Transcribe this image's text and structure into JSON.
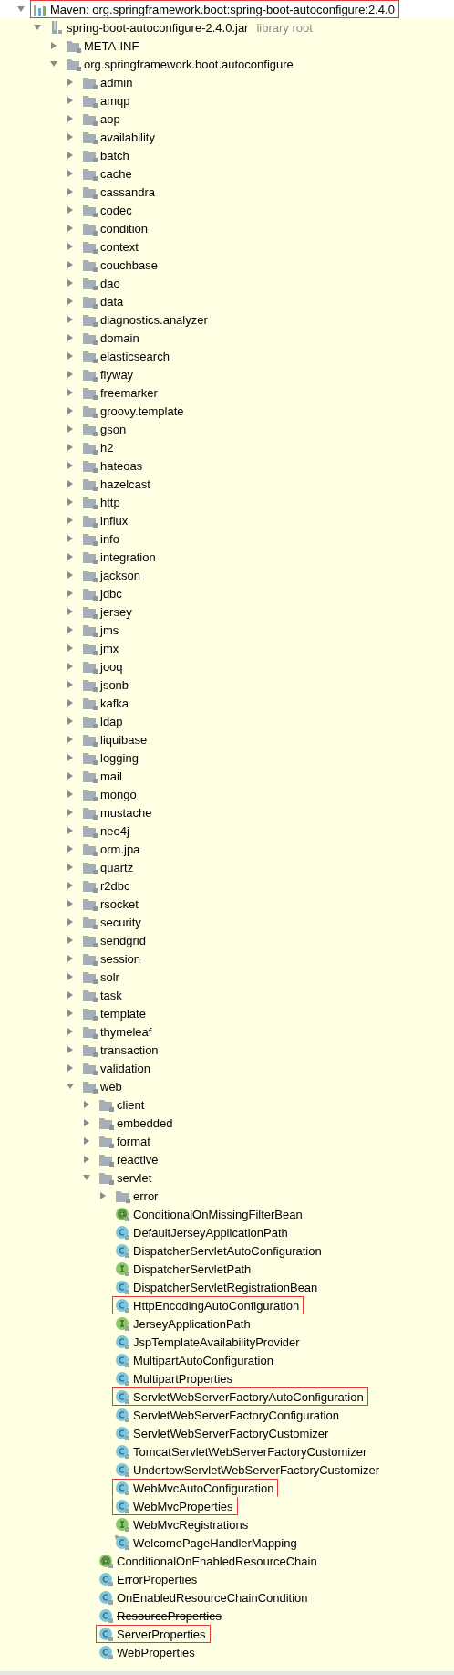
{
  "tree": [
    {
      "label": "Maven: org.springframework.boot:spring-boot-autoconfigure:2.4.0",
      "kind": "library",
      "expanded": true,
      "highlighted": true,
      "children": [
        {
          "label": "spring-boot-autoconfigure-2.4.0.jar",
          "note": "library root",
          "kind": "jar",
          "expanded": true,
          "children": [
            {
              "label": "META-INF",
              "kind": "folder",
              "expanded": false
            },
            {
              "label": "org.springframework.boot.autoconfigure",
              "kind": "folder",
              "expanded": true,
              "children": [
                {
                  "label": "admin",
                  "kind": "folder",
                  "expanded": false
                },
                {
                  "label": "amqp",
                  "kind": "folder",
                  "expanded": false
                },
                {
                  "label": "aop",
                  "kind": "folder",
                  "expanded": false
                },
                {
                  "label": "availability",
                  "kind": "folder",
                  "expanded": false
                },
                {
                  "label": "batch",
                  "kind": "folder",
                  "expanded": false
                },
                {
                  "label": "cache",
                  "kind": "folder",
                  "expanded": false
                },
                {
                  "label": "cassandra",
                  "kind": "folder",
                  "expanded": false
                },
                {
                  "label": "codec",
                  "kind": "folder",
                  "expanded": false
                },
                {
                  "label": "condition",
                  "kind": "folder",
                  "expanded": false
                },
                {
                  "label": "context",
                  "kind": "folder",
                  "expanded": false
                },
                {
                  "label": "couchbase",
                  "kind": "folder",
                  "expanded": false
                },
                {
                  "label": "dao",
                  "kind": "folder",
                  "expanded": false
                },
                {
                  "label": "data",
                  "kind": "folder",
                  "expanded": false
                },
                {
                  "label": "diagnostics.analyzer",
                  "kind": "folder",
                  "expanded": false
                },
                {
                  "label": "domain",
                  "kind": "folder",
                  "expanded": false
                },
                {
                  "label": "elasticsearch",
                  "kind": "folder",
                  "expanded": false
                },
                {
                  "label": "flyway",
                  "kind": "folder",
                  "expanded": false
                },
                {
                  "label": "freemarker",
                  "kind": "folder",
                  "expanded": false
                },
                {
                  "label": "groovy.template",
                  "kind": "folder",
                  "expanded": false
                },
                {
                  "label": "gson",
                  "kind": "folder",
                  "expanded": false
                },
                {
                  "label": "h2",
                  "kind": "folder",
                  "expanded": false
                },
                {
                  "label": "hateoas",
                  "kind": "folder",
                  "expanded": false
                },
                {
                  "label": "hazelcast",
                  "kind": "folder",
                  "expanded": false
                },
                {
                  "label": "http",
                  "kind": "folder",
                  "expanded": false
                },
                {
                  "label": "influx",
                  "kind": "folder",
                  "expanded": false
                },
                {
                  "label": "info",
                  "kind": "folder",
                  "expanded": false
                },
                {
                  "label": "integration",
                  "kind": "folder",
                  "expanded": false
                },
                {
                  "label": "jackson",
                  "kind": "folder",
                  "expanded": false
                },
                {
                  "label": "jdbc",
                  "kind": "folder",
                  "expanded": false
                },
                {
                  "label": "jersey",
                  "kind": "folder",
                  "expanded": false
                },
                {
                  "label": "jms",
                  "kind": "folder",
                  "expanded": false
                },
                {
                  "label": "jmx",
                  "kind": "folder",
                  "expanded": false
                },
                {
                  "label": "jooq",
                  "kind": "folder",
                  "expanded": false
                },
                {
                  "label": "jsonb",
                  "kind": "folder",
                  "expanded": false
                },
                {
                  "label": "kafka",
                  "kind": "folder",
                  "expanded": false
                },
                {
                  "label": "ldap",
                  "kind": "folder",
                  "expanded": false
                },
                {
                  "label": "liquibase",
                  "kind": "folder",
                  "expanded": false
                },
                {
                  "label": "logging",
                  "kind": "folder",
                  "expanded": false
                },
                {
                  "label": "mail",
                  "kind": "folder",
                  "expanded": false
                },
                {
                  "label": "mongo",
                  "kind": "folder",
                  "expanded": false
                },
                {
                  "label": "mustache",
                  "kind": "folder",
                  "expanded": false
                },
                {
                  "label": "neo4j",
                  "kind": "folder",
                  "expanded": false
                },
                {
                  "label": "orm.jpa",
                  "kind": "folder",
                  "expanded": false
                },
                {
                  "label": "quartz",
                  "kind": "folder",
                  "expanded": false
                },
                {
                  "label": "r2dbc",
                  "kind": "folder",
                  "expanded": false
                },
                {
                  "label": "rsocket",
                  "kind": "folder",
                  "expanded": false
                },
                {
                  "label": "security",
                  "kind": "folder",
                  "expanded": false
                },
                {
                  "label": "sendgrid",
                  "kind": "folder",
                  "expanded": false
                },
                {
                  "label": "session",
                  "kind": "folder",
                  "expanded": false
                },
                {
                  "label": "solr",
                  "kind": "folder",
                  "expanded": false
                },
                {
                  "label": "task",
                  "kind": "folder",
                  "expanded": false
                },
                {
                  "label": "template",
                  "kind": "folder",
                  "expanded": false
                },
                {
                  "label": "thymeleaf",
                  "kind": "folder",
                  "expanded": false
                },
                {
                  "label": "transaction",
                  "kind": "folder",
                  "expanded": false
                },
                {
                  "label": "validation",
                  "kind": "folder",
                  "expanded": false
                },
                {
                  "label": "web",
                  "kind": "folder",
                  "expanded": true,
                  "children": [
                    {
                      "label": "client",
                      "kind": "folder",
                      "expanded": false
                    },
                    {
                      "label": "embedded",
                      "kind": "folder",
                      "expanded": false
                    },
                    {
                      "label": "format",
                      "kind": "folder",
                      "expanded": false
                    },
                    {
                      "label": "reactive",
                      "kind": "folder",
                      "expanded": false
                    },
                    {
                      "label": "servlet",
                      "kind": "folder",
                      "expanded": true,
                      "children": [
                        {
                          "label": "error",
                          "kind": "folder",
                          "expanded": false
                        },
                        {
                          "label": "ConditionalOnMissingFilterBean",
                          "kind": "annotation"
                        },
                        {
                          "label": "DefaultJerseyApplicationPath",
                          "kind": "class"
                        },
                        {
                          "label": "DispatcherServletAutoConfiguration",
                          "kind": "class"
                        },
                        {
                          "label": "DispatcherServletPath",
                          "kind": "interface"
                        },
                        {
                          "label": "DispatcherServletRegistrationBean",
                          "kind": "class"
                        },
                        {
                          "label": "HttpEncodingAutoConfiguration",
                          "kind": "class",
                          "highlighted": true
                        },
                        {
                          "label": "JerseyApplicationPath",
                          "kind": "interface"
                        },
                        {
                          "label": "JspTemplateAvailabilityProvider",
                          "kind": "class"
                        },
                        {
                          "label": "MultipartAutoConfiguration",
                          "kind": "class"
                        },
                        {
                          "label": "MultipartProperties",
                          "kind": "class"
                        },
                        {
                          "label": "ServletWebServerFactoryAutoConfiguration",
                          "kind": "class",
                          "highlighted": true
                        },
                        {
                          "label": "ServletWebServerFactoryConfiguration",
                          "kind": "class"
                        },
                        {
                          "label": "ServletWebServerFactoryCustomizer",
                          "kind": "class"
                        },
                        {
                          "label": "TomcatServletWebServerFactoryCustomizer",
                          "kind": "class"
                        },
                        {
                          "label": "UndertowServletWebServerFactoryCustomizer",
                          "kind": "class"
                        },
                        {
                          "label": "WebMvcAutoConfiguration",
                          "kind": "class",
                          "highlighted": true
                        },
                        {
                          "label": "WebMvcProperties",
                          "kind": "class",
                          "highlighted": true
                        },
                        {
                          "label": "WebMvcRegistrations",
                          "kind": "interface"
                        },
                        {
                          "label": "WelcomePageHandlerMapping",
                          "kind": "marked"
                        }
                      ]
                    },
                    {
                      "label": "ConditionalOnEnabledResourceChain",
                      "kind": "annotation"
                    },
                    {
                      "label": "ErrorProperties",
                      "kind": "class"
                    },
                    {
                      "label": "OnEnabledResourceChainCondition",
                      "kind": "class"
                    },
                    {
                      "label": "ResourceProperties",
                      "kind": "class",
                      "deprecated": true
                    },
                    {
                      "label": "ServerProperties",
                      "kind": "class",
                      "highlighted": true
                    },
                    {
                      "label": "WebProperties",
                      "kind": "class"
                    }
                  ]
                }
              ]
            }
          ]
        }
      ]
    }
  ]
}
